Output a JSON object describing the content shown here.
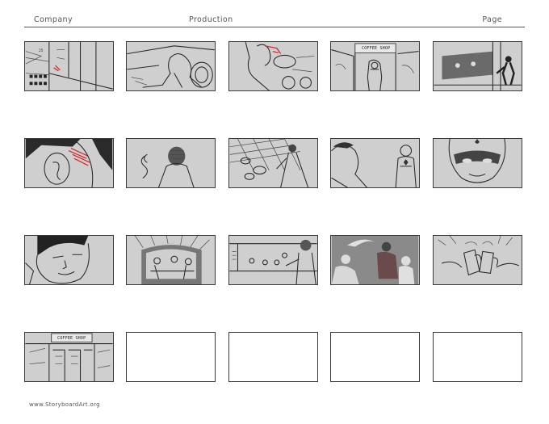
{
  "header": {
    "company_label": "Company",
    "production_label": "Production",
    "page_label": "Page"
  },
  "panels": [
    {
      "id": 1,
      "scene": "street-alley",
      "sketched": true,
      "sign_text": "",
      "red_marks": true,
      "number_text": "25"
    },
    {
      "id": 2,
      "scene": "motorcycle-rider",
      "sketched": true,
      "sign_text": "",
      "red_marks": false
    },
    {
      "id": 3,
      "scene": "rider-closeup",
      "sketched": true,
      "sign_text": "",
      "red_marks": true
    },
    {
      "id": 4,
      "scene": "coffee-shop-entrance",
      "sketched": true,
      "sign_text": "COFFEE SHOP",
      "red_marks": false
    },
    {
      "id": 5,
      "scene": "figure-at-window",
      "sketched": true,
      "sign_text": "",
      "red_marks": false
    },
    {
      "id": 6,
      "scene": "ear-closeup",
      "sketched": true,
      "sign_text": "",
      "red_marks": true
    },
    {
      "id": 7,
      "scene": "head-from-behind",
      "sketched": true,
      "sign_text": "",
      "red_marks": false
    },
    {
      "id": 8,
      "scene": "kitchen-counter",
      "sketched": true,
      "sign_text": "",
      "red_marks": false
    },
    {
      "id": 9,
      "scene": "two-figures",
      "sketched": true,
      "sign_text": "",
      "red_marks": false
    },
    {
      "id": 10,
      "scene": "masked-hero-face",
      "sketched": true,
      "sign_text": "",
      "red_marks": false
    },
    {
      "id": 11,
      "scene": "man-smiling",
      "sketched": true,
      "sign_text": "",
      "red_marks": false
    },
    {
      "id": 12,
      "scene": "booth-interior",
      "sketched": true,
      "sign_text": "",
      "red_marks": false
    },
    {
      "id": 13,
      "scene": "diner-counter",
      "sketched": true,
      "sign_text": "",
      "red_marks": false
    },
    {
      "id": 14,
      "scene": "group-dark",
      "sketched": true,
      "sign_text": "",
      "red_marks": false
    },
    {
      "id": 15,
      "scene": "mugs-toast",
      "sketched": true,
      "sign_text": "",
      "red_marks": false
    },
    {
      "id": 16,
      "scene": "coffee-shop-exterior",
      "sketched": true,
      "sign_text": "COFFEE SHOP",
      "red_marks": false
    },
    {
      "id": 17,
      "scene": "blank",
      "sketched": false,
      "sign_text": "",
      "red_marks": false
    },
    {
      "id": 18,
      "scene": "blank",
      "sketched": false,
      "sign_text": "",
      "red_marks": false
    },
    {
      "id": 19,
      "scene": "blank",
      "sketched": false,
      "sign_text": "",
      "red_marks": false
    },
    {
      "id": 20,
      "scene": "blank",
      "sketched": false,
      "sign_text": "",
      "red_marks": false
    }
  ],
  "footer": {
    "website": "www.StoryboardArt.org"
  }
}
